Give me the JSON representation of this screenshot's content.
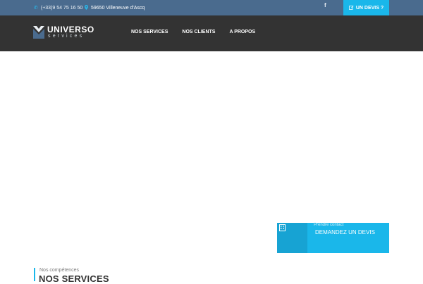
{
  "colors": {
    "topbar_bg": "#4a6b8e",
    "header_bg": "#333333",
    "accent": "#1ab7ea"
  },
  "topbar": {
    "phone_icon": "phone-icon",
    "phone": "(+33)9 54 75 16 50",
    "location_icon": "map-pin-icon",
    "address": "59650 Villeneuve d'Ascq",
    "social_icon": "facebook-icon",
    "social_label": "f",
    "devis_icon": "edit-icon",
    "devis_label": "UN DEVIS ?"
  },
  "logo": {
    "title": "UNIVERSO",
    "subtitle": "services"
  },
  "nav": {
    "items": [
      {
        "label": "NOS SERVICES"
      },
      {
        "label": "NOS CLIENTS"
      },
      {
        "label": "A PROPOS"
      }
    ]
  },
  "contact_card": {
    "icon": "building-icon",
    "small": "Prendre contact",
    "big": "DEMANDEZ UN DEVIS"
  },
  "section": {
    "eyebrow": "Nos compétences",
    "title": "NOS SERVICES"
  }
}
